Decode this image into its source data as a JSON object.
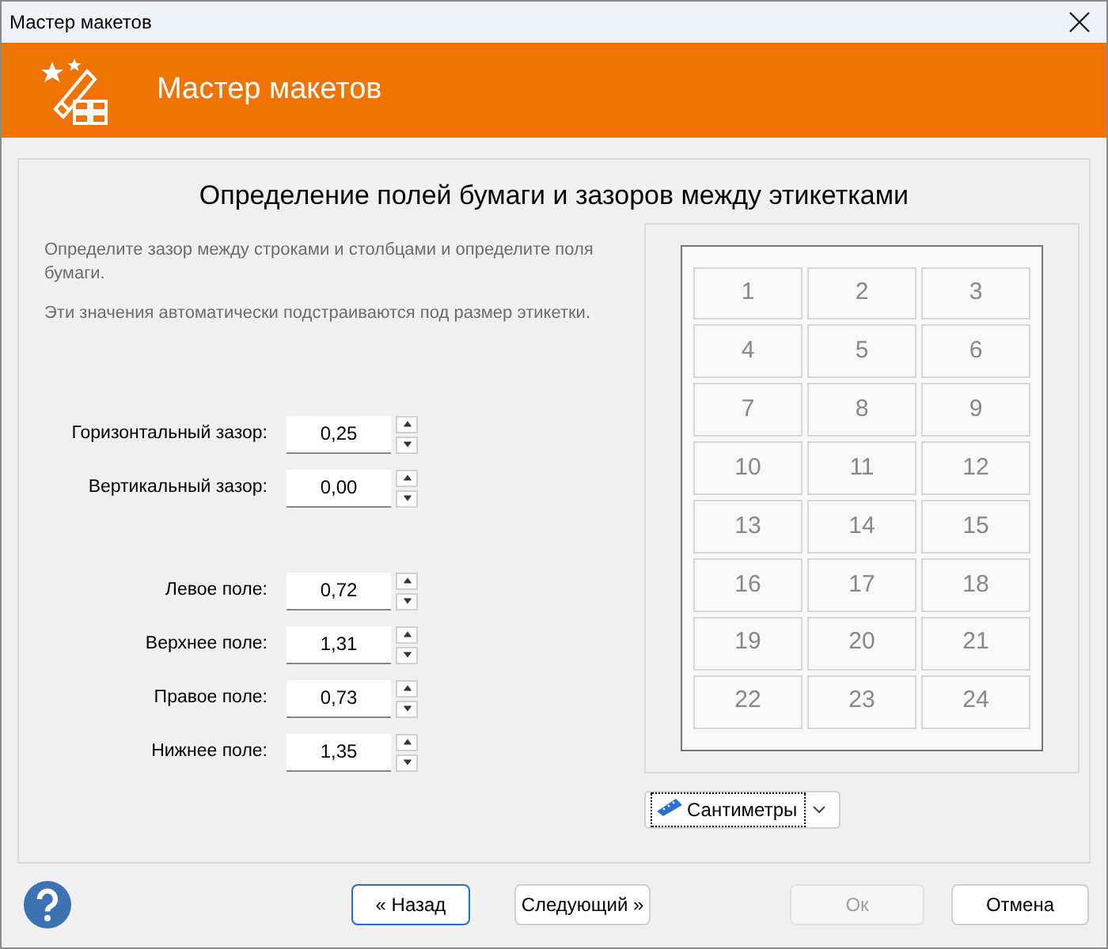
{
  "window": {
    "title": "Мастер макетов"
  },
  "header": {
    "title": "Мастер макетов"
  },
  "heading": "Определение полей бумаги и зазоров между этикетками",
  "description": [
    "Определите зазор между строками и столбцами и определите поля бумаги.",
    "Эти значения автоматически подстраиваются под размер этикетки."
  ],
  "field_groups": [
    [
      {
        "label": "Горизонтальный зазор:",
        "value": "0,25"
      },
      {
        "label": "Вертикальный зазор:",
        "value": "0,00"
      }
    ],
    [
      {
        "label": "Левое поле:",
        "value": "0,72"
      },
      {
        "label": "Верхнее поле:",
        "value": "1,31"
      },
      {
        "label": "Правое поле:",
        "value": "0,73"
      },
      {
        "label": "Нижнее поле:",
        "value": "1,35"
      }
    ]
  ],
  "preview": {
    "labels": [
      "1",
      "2",
      "3",
      "4",
      "5",
      "6",
      "7",
      "8",
      "9",
      "10",
      "11",
      "12",
      "13",
      "14",
      "15",
      "16",
      "17",
      "18",
      "19",
      "20",
      "21",
      "22",
      "23",
      "24"
    ]
  },
  "units": {
    "value": "Сантиметры"
  },
  "buttons": [
    {
      "label": "« Назад",
      "focused": true,
      "disabled": false
    },
    {
      "label": "Следующий »",
      "focused": false,
      "disabled": false
    },
    {
      "label": "Ок",
      "focused": false,
      "disabled": true
    },
    {
      "label": "Отмена",
      "focused": false,
      "disabled": false
    }
  ]
}
